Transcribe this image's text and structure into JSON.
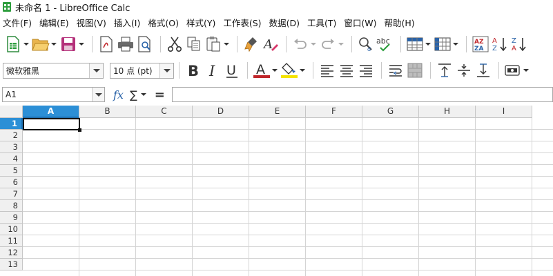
{
  "window": {
    "title": "未命名 1 - LibreOffice Calc"
  },
  "menu": [
    "文件(F)",
    "编辑(E)",
    "视图(V)",
    "插入(I)",
    "格式(O)",
    "样式(Y)",
    "工作表(S)",
    "数据(D)",
    "工具(T)",
    "窗口(W)",
    "帮助(H)"
  ],
  "format": {
    "font_name": "微软雅黑",
    "font_size": "10 点 (pt)",
    "font_color": "#c0262b",
    "highlight_color": "#f5e400"
  },
  "formula": {
    "name_box": "A1",
    "fx_label": "fx",
    "sigma_label": "∑",
    "equals_label": "=",
    "content": ""
  },
  "sheet": {
    "columns": [
      "A",
      "B",
      "C",
      "D",
      "E",
      "F",
      "G",
      "H",
      "I"
    ],
    "rows": [
      "1",
      "2",
      "3",
      "4",
      "5",
      "6",
      "7",
      "8",
      "9",
      "10",
      "11",
      "12",
      "13"
    ],
    "active_column": "A",
    "active_row": "1",
    "accent_color": "#2c8fd6"
  }
}
